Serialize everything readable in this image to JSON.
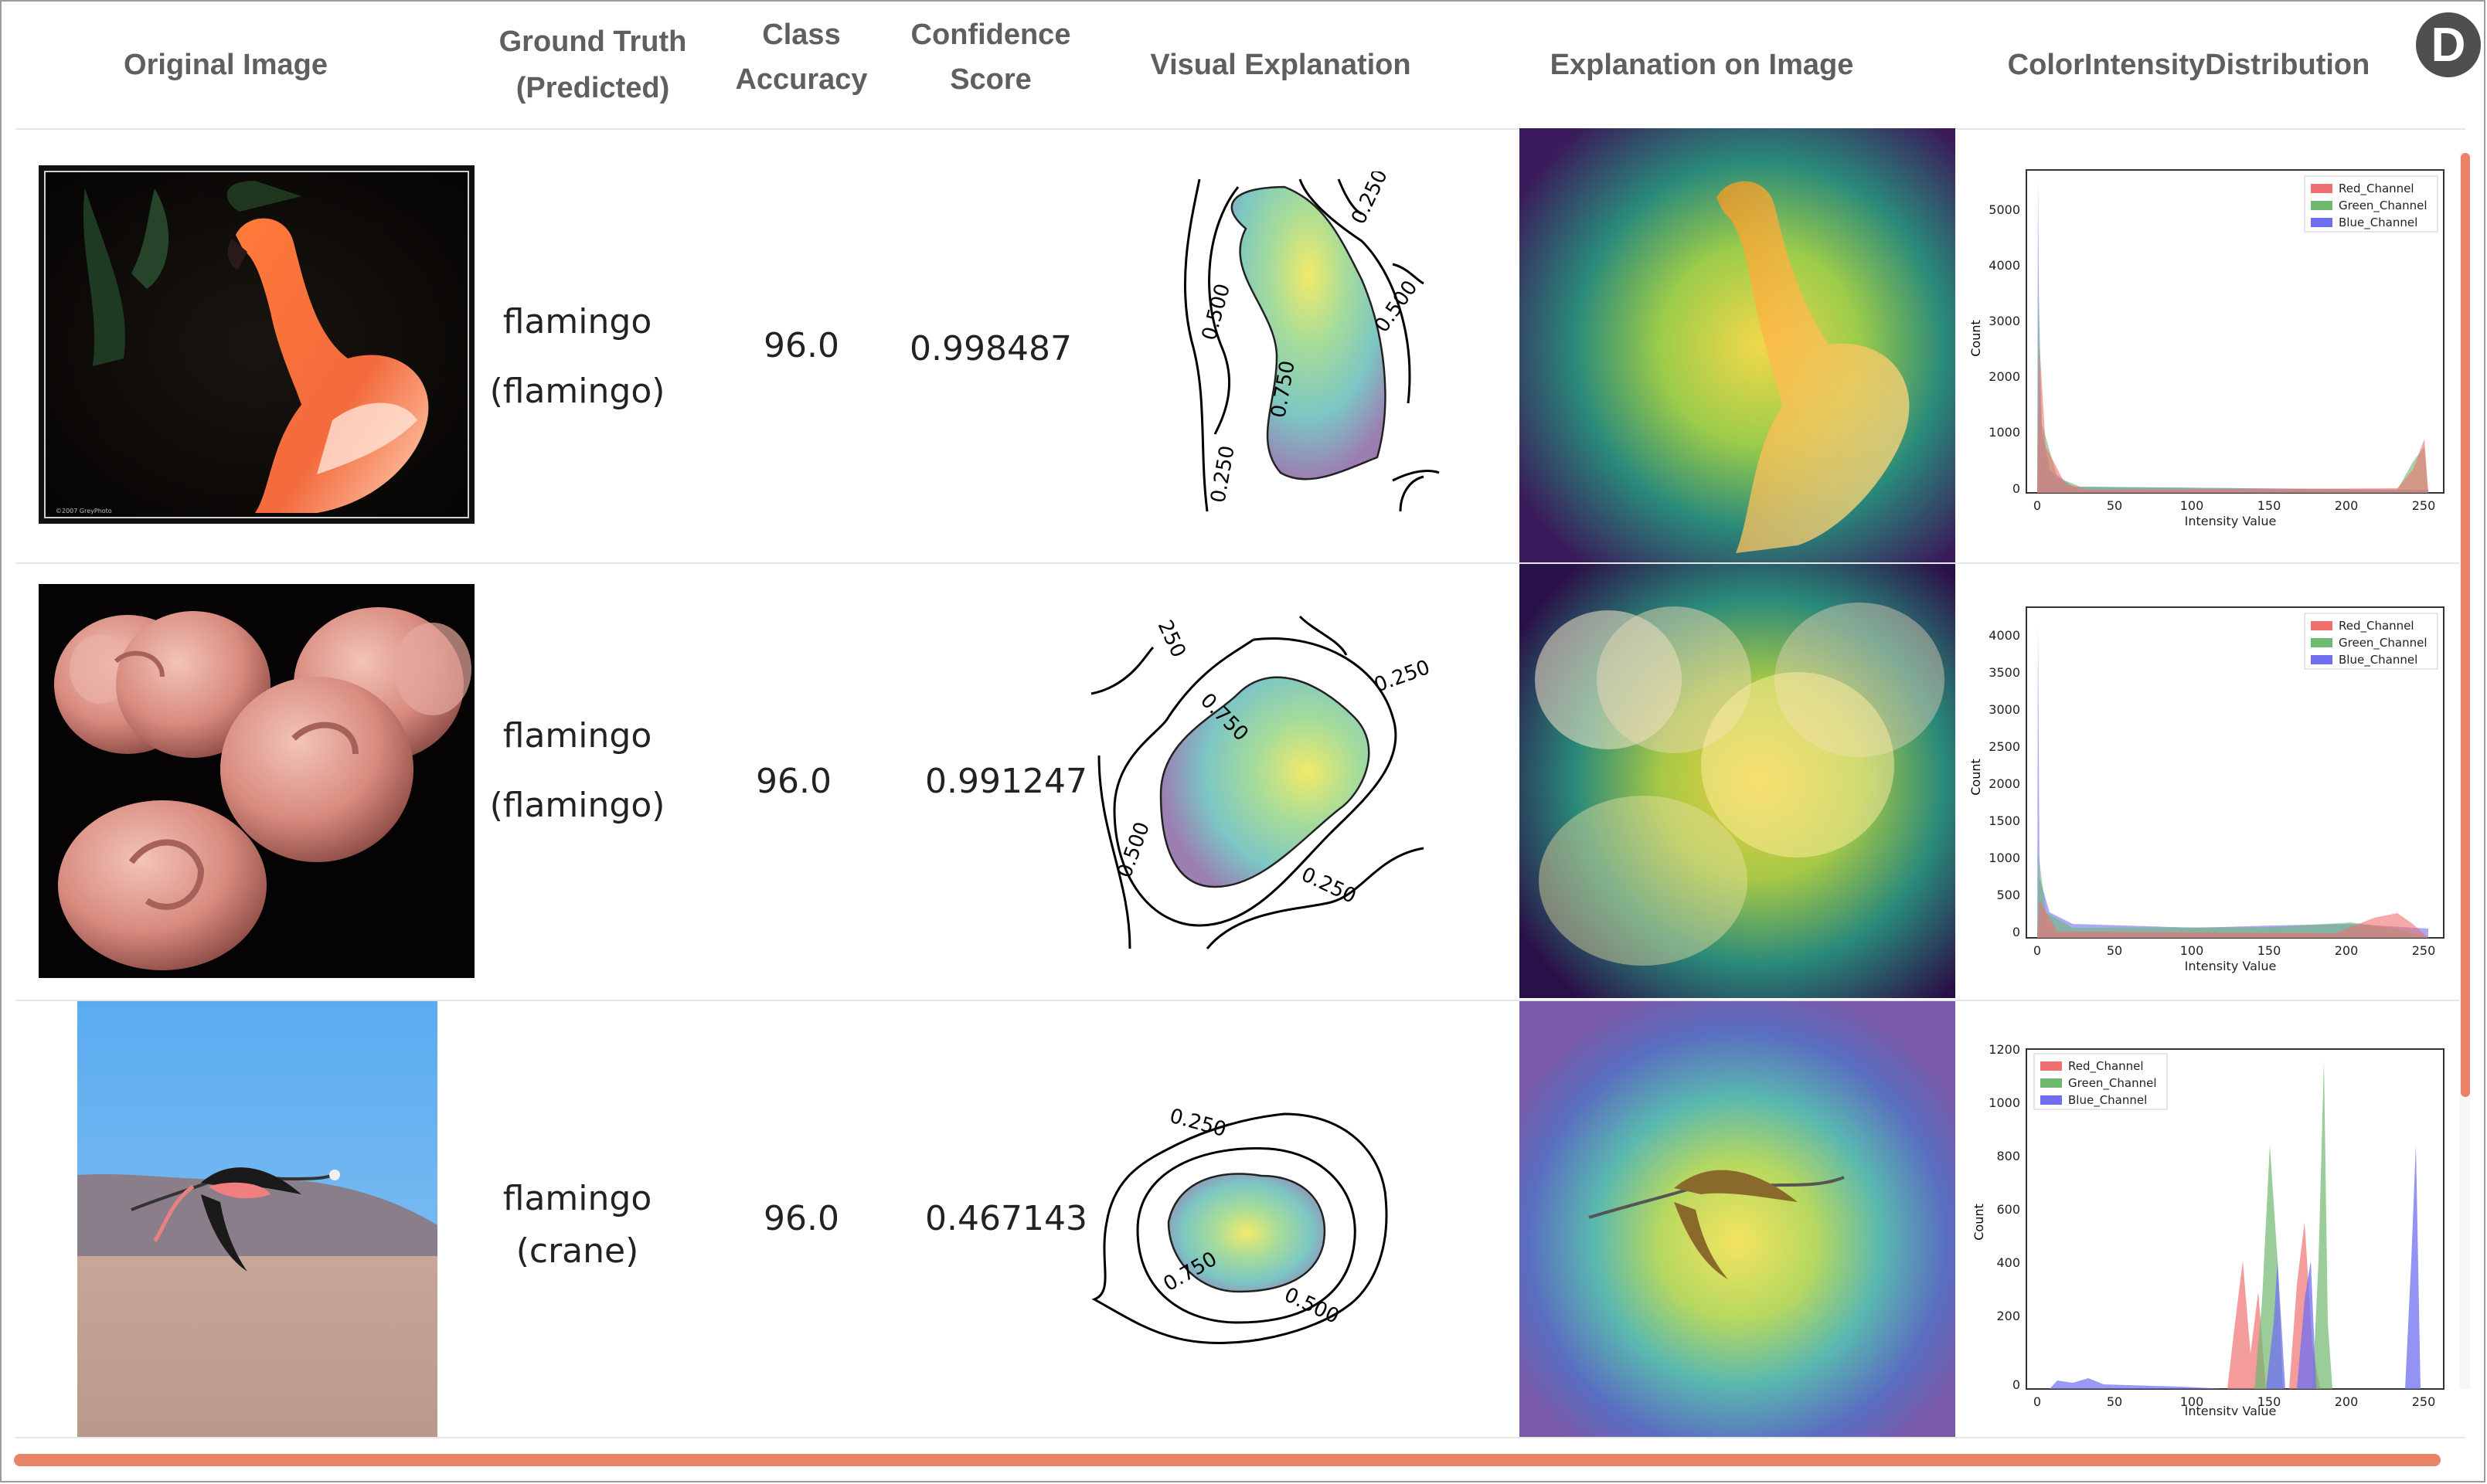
{
  "header": {
    "original_image": "Original Image",
    "ground_truth_line1": "Ground Truth",
    "ground_truth_line2": "(Predicted)",
    "class_accuracy_line1": "Class",
    "class_accuracy_line2": "Accuracy",
    "confidence_line1": "Confidence",
    "confidence_line2": "Score",
    "visual_explanation": "Visual Explanation",
    "explanation_on_image": "Explanation on Image",
    "color_intensity": "ColorIntensityDistribution"
  },
  "badge": "D",
  "rows": [
    {
      "ground_truth": "flamingo",
      "predicted": "(flamingo)",
      "class_accuracy": "96.0",
      "confidence": "0.998487",
      "contour_labels": [
        "0.250",
        "0.500",
        "0.500",
        "0.750",
        "0.250"
      ],
      "hist_yticks": [
        "5000",
        "4000",
        "3000",
        "2000",
        "1000",
        "0"
      ]
    },
    {
      "ground_truth": "flamingo",
      "predicted": "(flamingo)",
      "class_accuracy": "96.0",
      "confidence": "0.991247",
      "contour_labels": [
        "250",
        "0.250",
        "0.750",
        "0.500",
        "0.250"
      ],
      "hist_yticks": [
        "4000",
        "3500",
        "3000",
        "2500",
        "2000",
        "1500",
        "1000",
        "500",
        "0"
      ]
    },
    {
      "ground_truth": "flamingo",
      "predicted": "(crane)",
      "class_accuracy": "96.0",
      "confidence": "0.467143",
      "contour_labels": [
        "0.250",
        "0.750",
        "0.500"
      ],
      "hist_yticks": [
        "1200",
        "1000",
        "800",
        "600",
        "400",
        "200",
        "0"
      ]
    }
  ],
  "histogram": {
    "x_ticks": [
      "0",
      "50",
      "100",
      "150",
      "200",
      "250"
    ],
    "xlabel": "Intensity Value",
    "ylabel": "Count",
    "legend": [
      "Red_Channel",
      "Green_Channel",
      "Blue_Channel"
    ],
    "colors": {
      "red": "#f07070",
      "green": "#6fb86f",
      "blue": "#6f6ff0"
    }
  },
  "image_copyright": "©2007 GreyPhoto"
}
